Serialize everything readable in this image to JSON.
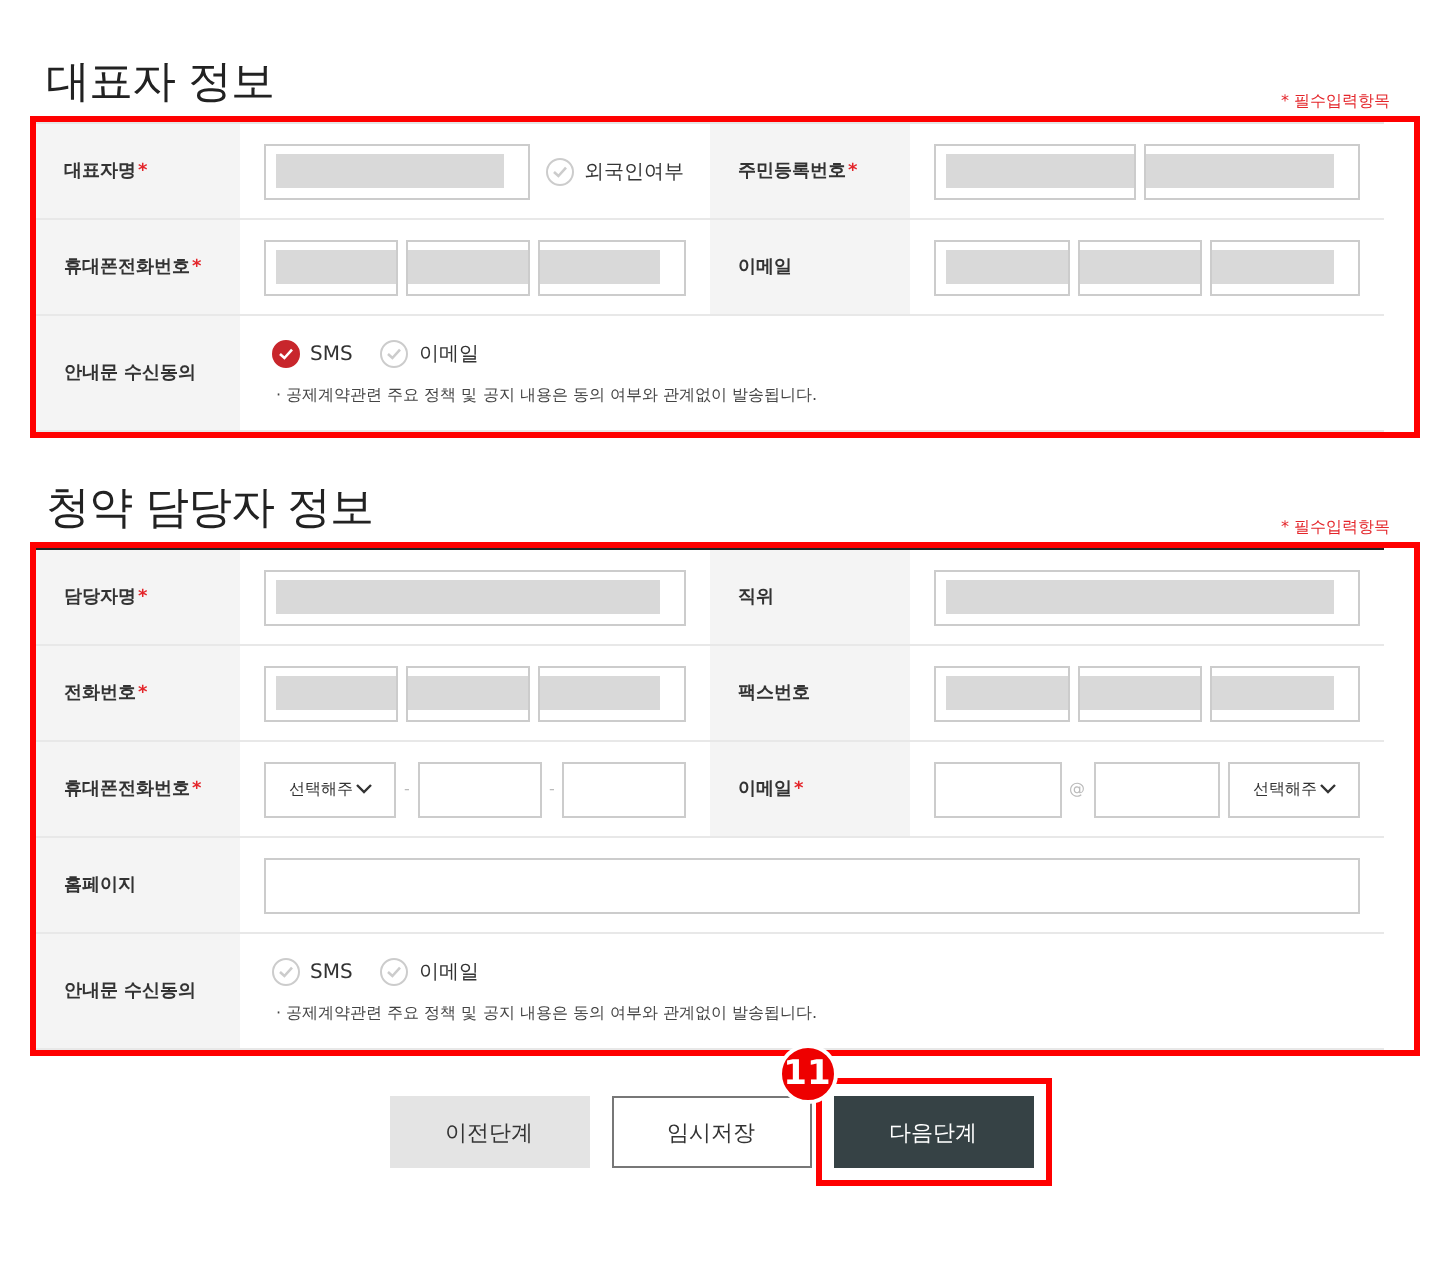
{
  "sections": [
    {
      "title": "대표자 정보",
      "required_note": "* 필수입력항목",
      "highlighted": true,
      "rows": [
        {
          "items": [
            {
              "label": "대표자명",
              "required_mark": "*",
              "controls": [
                {
                  "kind": "input_short",
                  "masked": true
                },
                {
                  "kind": "check",
                  "label": "외국인여부",
                  "checked": false
                }
              ]
            },
            {
              "label": "주민등록번호",
              "required_mark": "*",
              "controls": [
                {
                  "kind": "input_pair",
                  "masked": true
                }
              ]
            }
          ]
        },
        {
          "items": [
            {
              "label": "휴대폰전화번호",
              "required_mark": "*",
              "controls": [
                {
                  "kind": "input_triple",
                  "masked": true
                }
              ]
            },
            {
              "label": "이메일",
              "controls": [
                {
                  "kind": "input_triple",
                  "masked": true
                }
              ]
            }
          ]
        },
        {
          "items": [
            {
              "label": "안내문 수신동의",
              "controls": [
                {
                  "kind": "check",
                  "label": "SMS",
                  "checked": true
                },
                {
                  "kind": "check",
                  "label": "이메일",
                  "checked": false
                }
              ],
              "note": "· 공제계약관련 주요 정책 및 공지 내용은 동의 여부와 관계없이 발송됩니다."
            }
          ]
        }
      ]
    },
    {
      "title": "청약 담당자 정보",
      "required_note": "* 필수입력항목",
      "highlighted": true,
      "rows": [
        {
          "items": [
            {
              "label": "담당자명",
              "required_mark": "*",
              "controls": [
                {
                  "kind": "input",
                  "masked": true
                }
              ]
            },
            {
              "label": "직위",
              "controls": [
                {
                  "kind": "input",
                  "masked": true
                }
              ]
            }
          ]
        },
        {
          "items": [
            {
              "label": "전화번호",
              "required_mark": "*",
              "controls": [
                {
                  "kind": "input_triple",
                  "masked": true
                }
              ]
            },
            {
              "label": "팩스번호",
              "controls": [
                {
                  "kind": "input_triple",
                  "masked": true
                }
              ]
            }
          ]
        },
        {
          "items": [
            {
              "label": "휴대폰전화번호",
              "required_mark": "*",
              "controls": [
                {
                  "kind": "select",
                  "value": "선택해주"
                },
                {
                  "kind": "sep",
                  "text": "-"
                },
                {
                  "kind": "input"
                },
                {
                  "kind": "sep",
                  "text": "-"
                },
                {
                  "kind": "input"
                }
              ]
            },
            {
              "label": "이메일",
              "required_mark": "*",
              "controls": [
                {
                  "kind": "input"
                },
                {
                  "kind": "sep",
                  "text": "@"
                },
                {
                  "kind": "input"
                },
                {
                  "kind": "select",
                  "value": "선택해주"
                }
              ]
            }
          ]
        },
        {
          "items": [
            {
              "label": "홈페이지",
              "controls": [
                {
                  "kind": "input"
                }
              ]
            }
          ]
        },
        {
          "items": [
            {
              "label": "안내문 수신동의",
              "controls": [
                {
                  "kind": "check",
                  "label": "SMS",
                  "checked": false
                },
                {
                  "kind": "check",
                  "label": "이메일",
                  "checked": false
                }
              ],
              "note": "· 공제계약관련 주요 정책 및 공지 내용은 동의 여부와 관계없이 발송됩니다."
            }
          ]
        }
      ]
    }
  ],
  "buttons": [
    {
      "label": "이전단계",
      "kind": "prev",
      "highlighted": false
    },
    {
      "label": "임시저장",
      "kind": "save",
      "highlighted": false
    },
    {
      "label": "다음단계",
      "kind": "next",
      "highlighted": true,
      "badge": "11"
    }
  ]
}
